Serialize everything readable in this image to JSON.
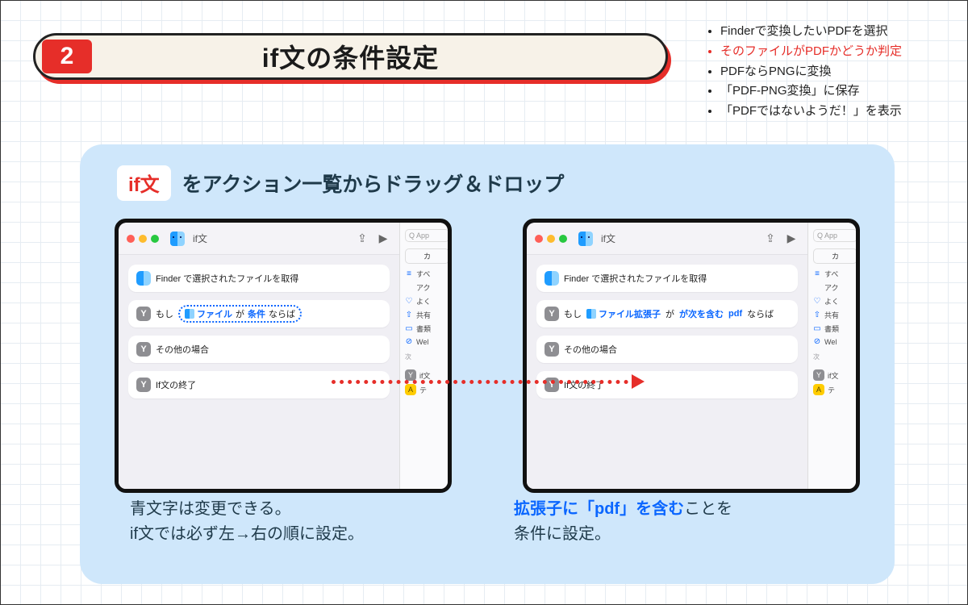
{
  "header": {
    "step": "2",
    "title": "if文の条件設定"
  },
  "checklist": {
    "items": [
      {
        "text": "Finderで変換したいPDFを選択",
        "highlight": false
      },
      {
        "text": "そのファイルがPDFかどうか判定",
        "highlight": true
      },
      {
        "text": "PDFならPNGに変換",
        "highlight": false
      },
      {
        "text": "「PDF-PNG変換」に保存",
        "highlight": false
      },
      {
        "text": "「PDFではないようだ！」を表示",
        "highlight": false
      }
    ]
  },
  "card": {
    "pill": "if文",
    "title_rest": "をアクション一覧からドラッグ＆ドロップ"
  },
  "window_common": {
    "title": "if文",
    "share_icon": "⇪",
    "play_icon": "▶",
    "search_placeholder": "App",
    "side_cat": "カ",
    "side": {
      "all": "すべ",
      "all2": "アク",
      "fav": "よく",
      "share": "共有",
      "doc": "書類",
      "web": "Wel"
    },
    "section_next": "次",
    "tag_if": "if文",
    "tag_te": "テ"
  },
  "win_left": {
    "row1": "Finder で選択されたファイルを取得",
    "row2": {
      "pre": "もし",
      "file": "ファイル",
      "ga": "が",
      "cond": "条件",
      "post": "ならば"
    },
    "row3": "その他の場合",
    "row4": "If文の終了"
  },
  "win_right": {
    "row1": "Finder で選択されたファイルを取得",
    "row2": {
      "pre": "もし",
      "file": "ファイル拡張子",
      "ga": "が",
      "cond": "が次を含む",
      "val": "pdf",
      "post": "ならば"
    },
    "row3": "その他の場合",
    "row4": "If文の終了"
  },
  "captions": {
    "c1a": "青文字は変更できる。",
    "c1b": "if文では必ず左→右の順に設定。",
    "c2_emph": "拡張子に「pdf」を含む",
    "c2_tail": "ことを",
    "c2b": "条件に設定。"
  }
}
